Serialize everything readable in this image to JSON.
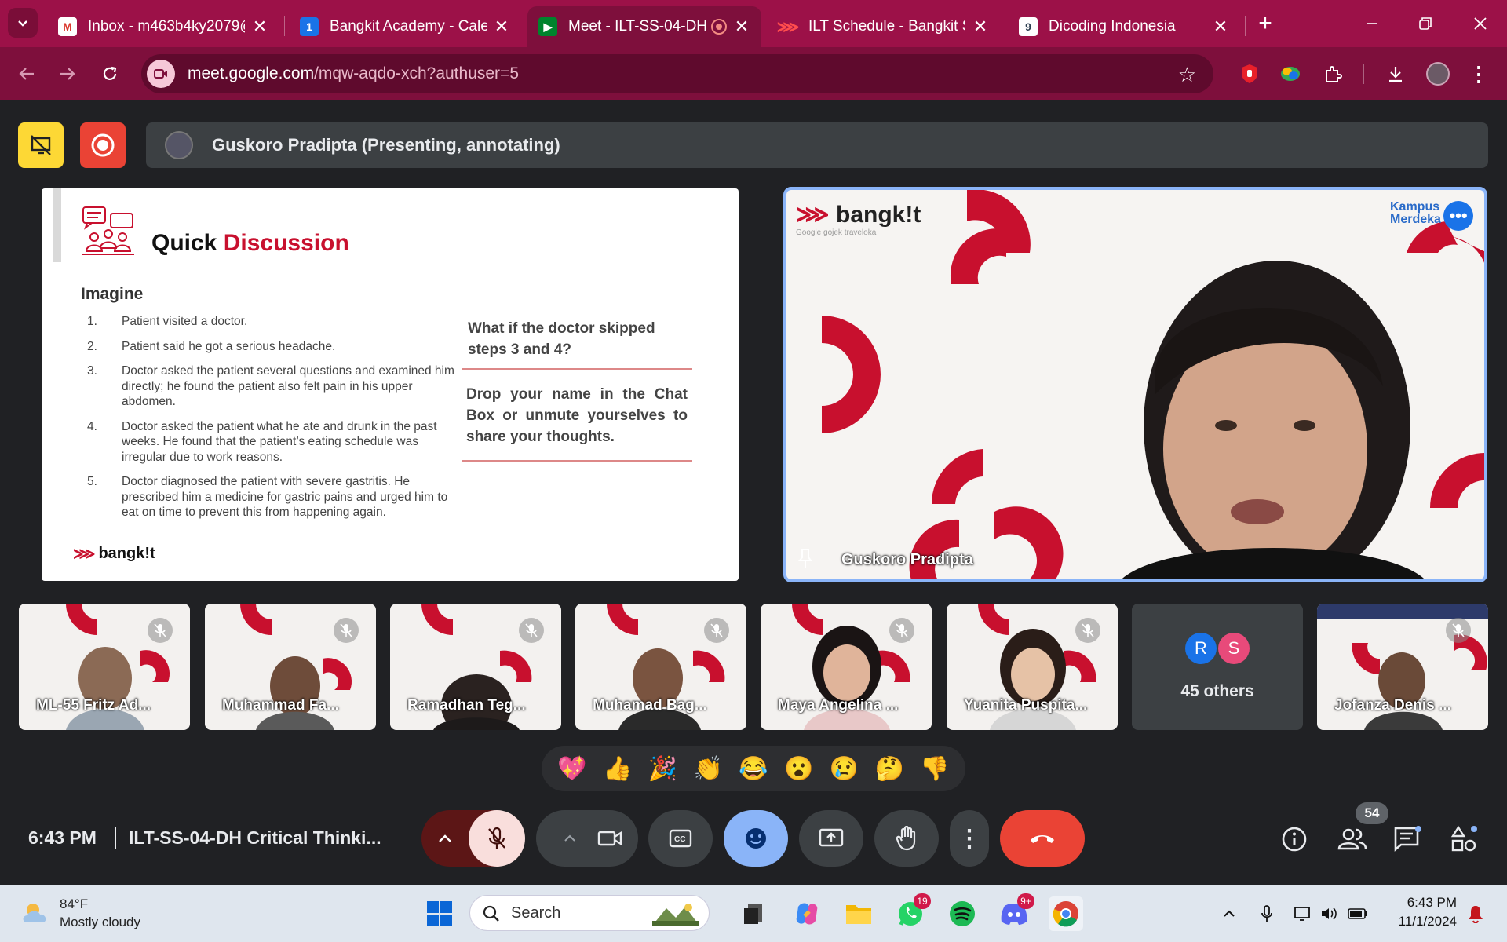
{
  "browser": {
    "tabs": [
      {
        "title": "Inbox - m463b4ky2079@",
        "close": "✕"
      },
      {
        "title": "Bangkit Academy - Calen",
        "close": "✕"
      },
      {
        "title": "Meet - ILT-SS-04-DH",
        "close": "✕"
      },
      {
        "title": "ILT Schedule - Bangkit St",
        "close": "✕"
      },
      {
        "title": "Dicoding Indonesia",
        "close": "✕"
      }
    ],
    "new_tab": "+",
    "url_host": "meet.google.com",
    "url_path": "/mqw-aqdo-xch?authuser=5"
  },
  "meet": {
    "presenting_label": "Guskoro Pradipta (Presenting, annotating)",
    "slide": {
      "title_main": "Quick",
      "title_accent": "Discussion",
      "subtitle": "Imagine",
      "items": [
        {
          "num": "1.",
          "text": "Patient visited a doctor."
        },
        {
          "num": "2.",
          "text": "Patient said he got a serious headache."
        },
        {
          "num": "3.",
          "text": "Doctor asked the patient several questions and examined him directly; he found the patient also felt pain in his upper abdomen."
        },
        {
          "num": "4.",
          "text": "Doctor asked the patient what he ate and drunk in the past weeks. He found that the patient’s eating schedule was irregular due to work reasons."
        },
        {
          "num": "5.",
          "text": "Doctor diagnosed the patient with severe gastritis. He prescribed him a medicine for gastric pains and urged him to eat on time to prevent this from happening again."
        }
      ],
      "question": "What if the doctor skipped steps 3 and 4?",
      "prompt": "Drop your name in the Chat Box or unmute yourselves to share your thoughts.",
      "logo": "bangk!t"
    },
    "speaker": {
      "name": "Guskoro Pradipta",
      "logo": "bangk!t",
      "sponsors": "Google   gojek   traveloka",
      "corner_logo": "Kampus Merdeka"
    },
    "participants": [
      {
        "name": "ML-55 Fritz Ad..."
      },
      {
        "name": "Muhammad Fa..."
      },
      {
        "name": "Ramadhan Teg..."
      },
      {
        "name": "Muhamad Bag..."
      },
      {
        "name": "Maya Angelina ..."
      },
      {
        "name": "Yuanita Puspita..."
      }
    ],
    "others": {
      "label": "45 others",
      "avatars": [
        "R",
        "S"
      ],
      "avatar_colors": [
        "#1a73e8",
        "#e84a7a"
      ]
    },
    "last_participant": {
      "name": "Jofanza Denis ..."
    },
    "reactions": [
      "💖",
      "👍",
      "🎉",
      "👏",
      "😂",
      "😮",
      "😢",
      "🤔",
      "👎"
    ],
    "time": "6:43 PM",
    "meeting_title": "ILT-SS-04-DH Critical Thinki...",
    "people_count": "54"
  },
  "taskbar": {
    "temp": "84°F",
    "weather": "Mostly cloudy",
    "search_placeholder": "Search",
    "whatsapp_badge": "19",
    "discord_badge": "9+",
    "time": "6:43 PM",
    "date": "11/1/2024"
  },
  "colors": {
    "brand_red": "#c8102e",
    "tab_bar": "#9c1148",
    "toolbar": "#7e0f3c",
    "end_call": "#ea4335",
    "accent_blue": "#8ab4f8"
  }
}
